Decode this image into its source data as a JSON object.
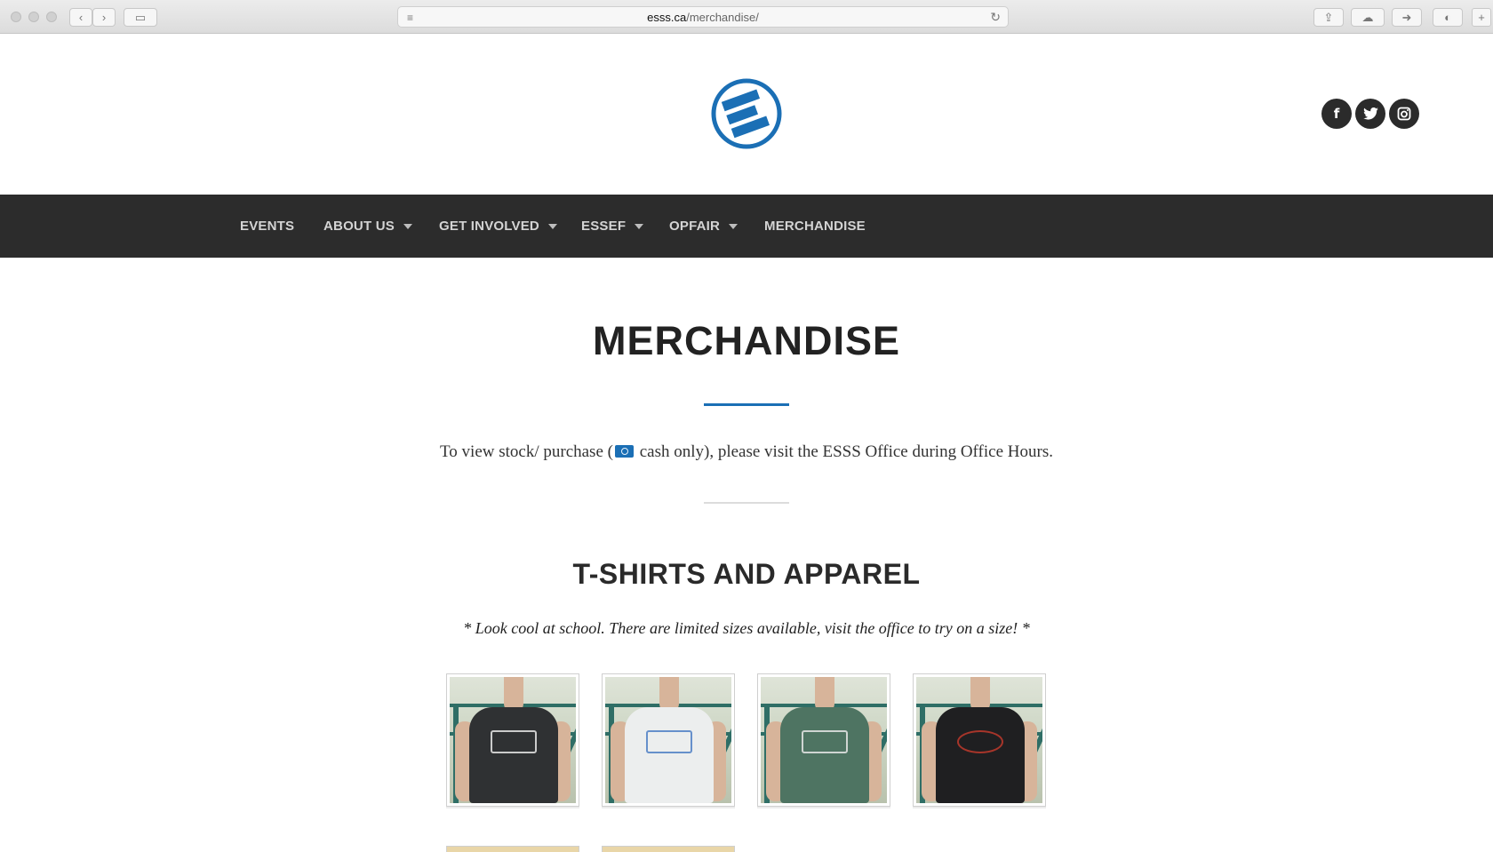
{
  "browser": {
    "url_host": "esss.ca",
    "url_path": "/merchandise/"
  },
  "header": {
    "logo_alt": "ESSS logo",
    "social": [
      {
        "name": "facebook",
        "glyph": "f"
      },
      {
        "name": "twitter",
        "glyph": "t"
      },
      {
        "name": "instagram",
        "glyph": "◎"
      }
    ]
  },
  "nav": {
    "items": [
      {
        "label": "EVENTS",
        "dropdown": false
      },
      {
        "label": "ABOUT US",
        "dropdown": true
      },
      {
        "label": "GET INVOLVED",
        "dropdown": true
      },
      {
        "label": "ESSEF",
        "dropdown": true
      },
      {
        "label": "OPFAIR",
        "dropdown": true
      },
      {
        "label": "MERCHANDISE",
        "dropdown": false
      }
    ]
  },
  "main": {
    "title": "MERCHANDISE",
    "intro_before": "To view stock/ purchase (",
    "intro_after": " cash only), please visit the ESSS Office during Office Hours.",
    "section_title": "T-SHIRTS AND APPAREL",
    "section_note": "* Look cool at school. There are limited sizes available, visit the office to try on a size! *"
  },
  "products": [
    {
      "name": "evolution-tee-charcoal",
      "shirt_color": "#2f3133",
      "print_color": "#e6e6e6"
    },
    {
      "name": "uniquely-engineered-tee-white",
      "shirt_color": "#eceeee",
      "print_color": "#4f7fc4"
    },
    {
      "name": "evolution-tee-green",
      "shirt_color": "#4e7462",
      "print_color": "#e6e6e6"
    },
    {
      "name": "globe-tee-black",
      "shirt_color": "#1f1f21",
      "print_color": "#c0392b"
    }
  ],
  "colors": {
    "accent": "#1b6fb5",
    "nav_bg": "#2c2c2c"
  }
}
